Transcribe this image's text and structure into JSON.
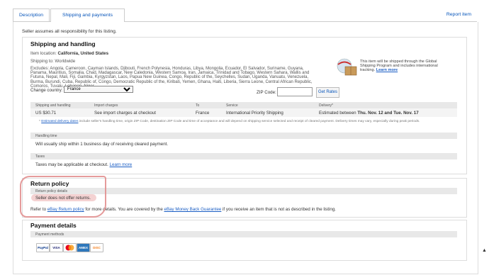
{
  "tabs": [
    {
      "label": "Description"
    },
    {
      "label": "Shipping and payments"
    }
  ],
  "report_item": "Report item",
  "seller_note": "Seller assumes all responsibility for this listing.",
  "shipping": {
    "heading": "Shipping and handling",
    "location_label": "Item location:",
    "location_value": "California, United States",
    "ships_to": "Shipping to: Worldwide",
    "excludes": "Excludes: Angola, Cameroon, Cayman Islands, Djibouti, French Polynesia, Honduras, Libya, Mongolia, Ecuador, El Salvador, Suriname, Guyana, Panama, Mauritius, Somalia, Chad, Madagascar, New Caledonia, Western Samoa, Iran, Jamaica, Trinidad and Tobago, Western Sahara, Wallis and Futuna, Nepal, Mali, Fiji, Gambia, Kyrgyzstan, Laos, Papua New Guinea, Congo, Republic of the, Seychelles, Sudan, Uganda, Vanuatu, Venezuela, Burma, Burundi, Cuba, Republic of, Congo, Democratic Republic of the, Kiribati, Yemen, Ghana, Haiti, Liberia, Sierra Leone, Central African Republic, Comoros, Tuvalu, Lebanon, Niger",
    "change_country_label": "Change country:",
    "country_selected": "France",
    "zip_label": "ZIP Code:",
    "zip_value": "",
    "get_rates": "Get Rates",
    "gsp_text": "This item will be shipped through the Global Shipping Program and includes international tracking.",
    "gsp_link": "Learn more",
    "table_headers": [
      "Shipping and handling",
      "Import charges",
      "To",
      "Service",
      "Delivery*"
    ],
    "row": {
      "cost": "US $30.71",
      "import": "See import charges at checkout",
      "to": "France",
      "service": "International Priority Shipping",
      "delivery_prefix": "Estimated between ",
      "delivery_dates": "Thu. Nov. 12 and Tue. Nov. 17"
    },
    "note_star": "*",
    "note_link": "Estimated delivery dates",
    "note_text": " include seller's handling time, origin ZIP Code, destination ZIP Code and time of acceptance and will depend on shipping service selected and receipt of cleared payment. Delivery times may vary, especially during peak periods.",
    "handling_title": "Handling time",
    "handling_text": "Will usually ship within 1 business day of receiving cleared payment.",
    "taxes_title": "Taxes",
    "taxes_text": "Taxes may be applicable at checkout.",
    "taxes_link": "Learn more"
  },
  "returns": {
    "heading": "Return policy",
    "details_title": "Return policy details",
    "details_text": "Seller does not offer returns.",
    "refer_prefix": "Refer to ",
    "refer_link1": "eBay Return policy",
    "refer_mid": " for more details. You are covered by the ",
    "refer_link2": "eBay Money Back Guarantee",
    "refer_suffix": " if you receive an item that is not as described in the listing."
  },
  "payment": {
    "heading": "Payment details",
    "methods_title": "Payment methods",
    "cards": [
      {
        "label": "PayPal",
        "color": "#003087"
      },
      {
        "label": "VISA",
        "color": "#1a1f71"
      },
      {
        "label": "MC",
        "color": "#eb001b"
      },
      {
        "label": "AMEX",
        "color": "#2e77bb"
      },
      {
        "label": "DISC",
        "color": "#f58220"
      }
    ]
  }
}
